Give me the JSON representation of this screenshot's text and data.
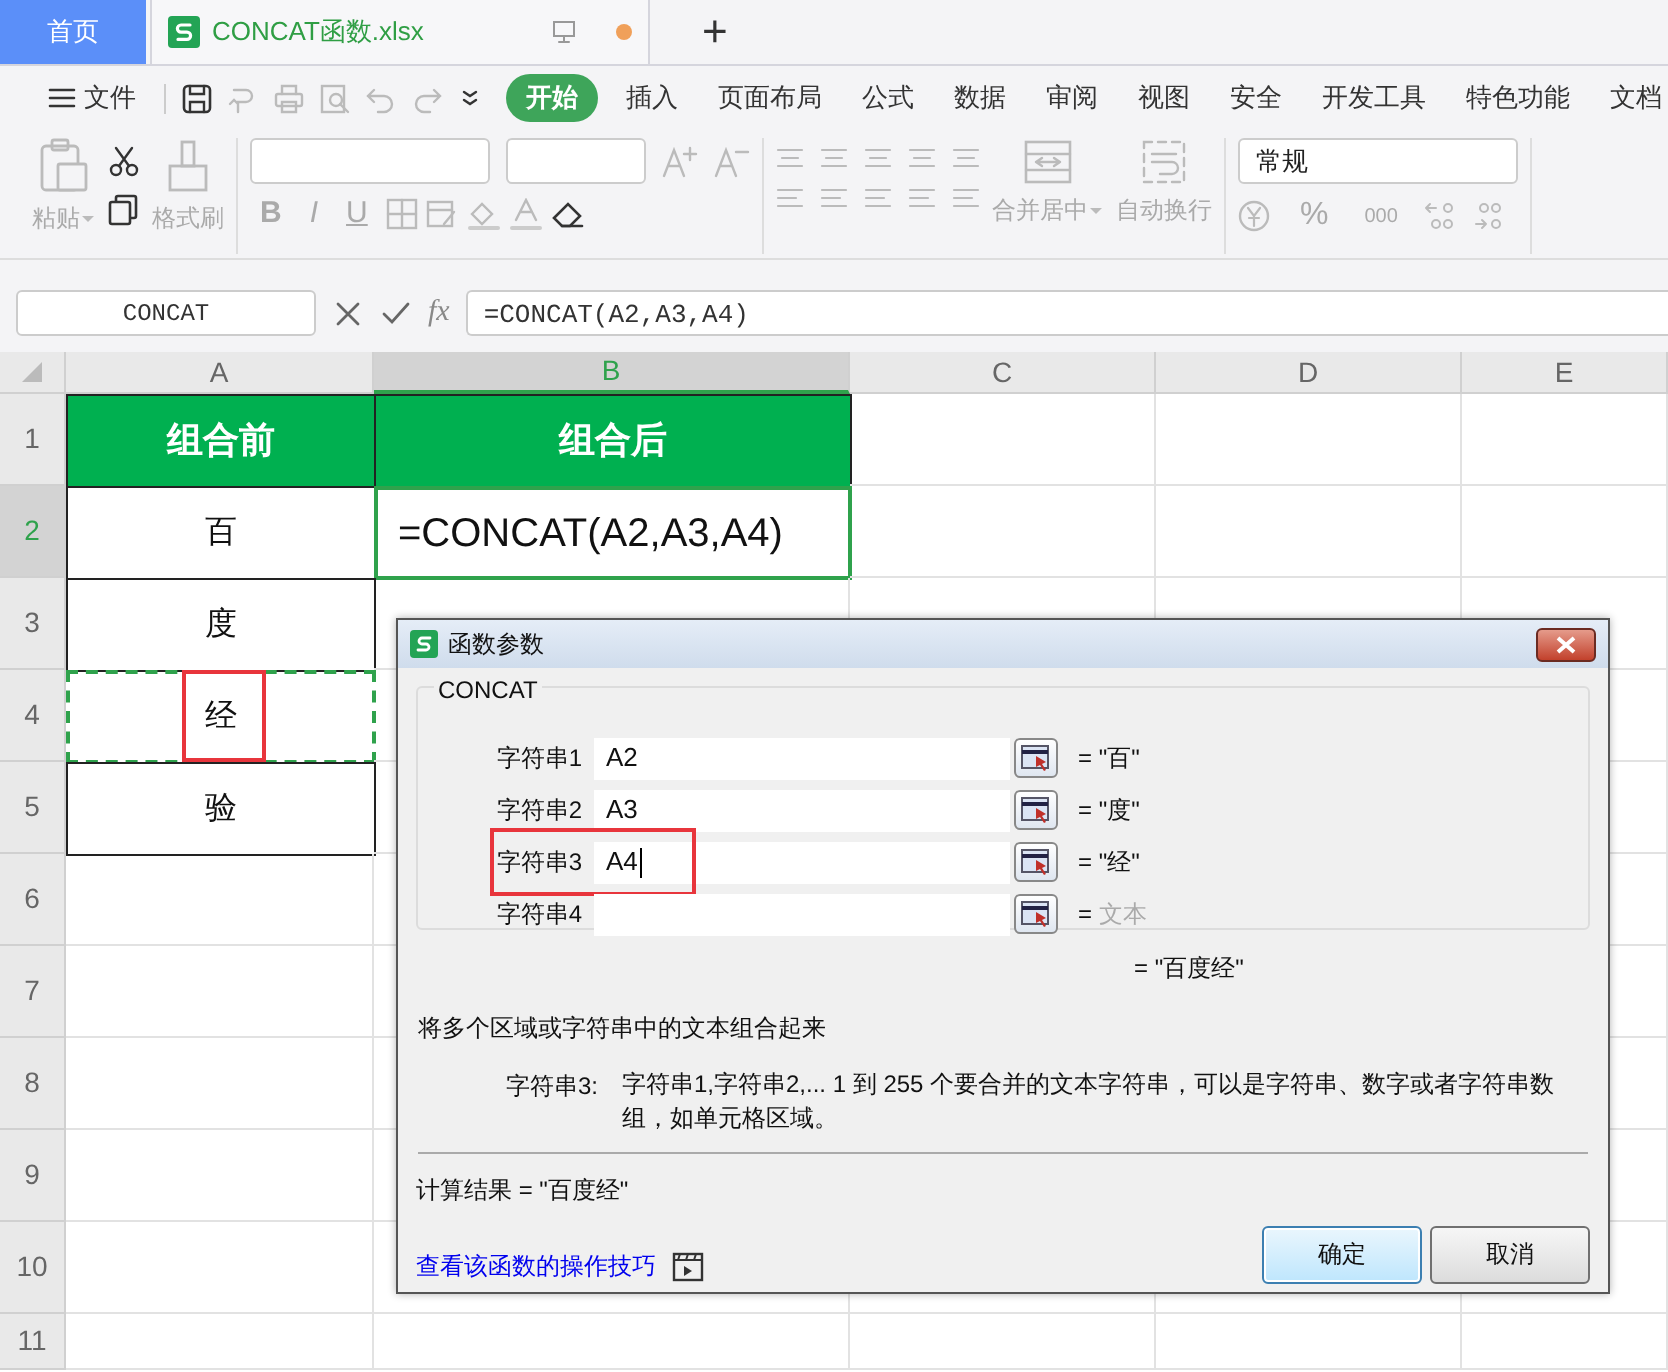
{
  "tabs": [
    {
      "label": "首页",
      "kind": "home",
      "selected": false
    },
    {
      "label": "CONCAT函数.xlsx",
      "kind": "file",
      "selected": true,
      "modified": true
    }
  ],
  "new_tab": "+",
  "file_menu": "文件",
  "menu": [
    {
      "label": "开始",
      "selected": true
    },
    {
      "label": "插入",
      "selected": false
    },
    {
      "label": "页面布局",
      "selected": false
    },
    {
      "label": "公式",
      "selected": false
    },
    {
      "label": "数据",
      "selected": false
    },
    {
      "label": "审阅",
      "selected": false
    },
    {
      "label": "视图",
      "selected": false
    },
    {
      "label": "安全",
      "selected": false
    },
    {
      "label": "开发工具",
      "selected": false
    },
    {
      "label": "特色功能",
      "selected": false
    },
    {
      "label": "文档",
      "selected": false
    }
  ],
  "ribbon": {
    "paste": "粘贴",
    "format_painter": "格式刷",
    "format_buttons": [
      "B",
      "I",
      "U"
    ],
    "merge": "合并居中",
    "wrap": "自动换行",
    "number_format": "常规",
    "number_buttons": [
      "%",
      "000"
    ]
  },
  "name_box": "CONCAT",
  "fx": "fx",
  "formula": "=CONCAT(A2,A3,A4)",
  "columns": [
    {
      "label": "A",
      "selected": false
    },
    {
      "label": "B",
      "selected": true
    },
    {
      "label": "C",
      "selected": false
    },
    {
      "label": "D",
      "selected": false
    },
    {
      "label": "E",
      "selected": false
    }
  ],
  "rows": [
    {
      "label": "1",
      "selected": false,
      "cells": [
        {
          "text": "组合前",
          "kind": "header",
          "selected": false
        },
        {
          "text": "组合后",
          "kind": "header",
          "selected": false
        }
      ]
    },
    {
      "label": "2",
      "selected": true,
      "cells": [
        {
          "text": "百",
          "kind": "value",
          "selected": false
        },
        {
          "text": "=CONCAT(A2,A3,A4)",
          "kind": "formula",
          "selected": true
        }
      ]
    },
    {
      "label": "3",
      "selected": false,
      "cells": [
        {
          "text": "度",
          "kind": "value",
          "selected": false
        }
      ]
    },
    {
      "label": "4",
      "selected": false,
      "cells": [
        {
          "text": "经",
          "kind": "value",
          "selected": false,
          "marquee": true,
          "highlighted": true
        }
      ]
    },
    {
      "label": "5",
      "selected": false,
      "cells": [
        {
          "text": "验",
          "kind": "value",
          "selected": false
        }
      ]
    },
    {
      "label": "6",
      "selected": false,
      "cells": []
    },
    {
      "label": "7",
      "selected": false,
      "cells": []
    },
    {
      "label": "8",
      "selected": false,
      "cells": []
    },
    {
      "label": "9",
      "selected": false,
      "cells": []
    },
    {
      "label": "10",
      "selected": false,
      "cells": []
    },
    {
      "label": "11",
      "selected": false,
      "cells": []
    }
  ],
  "dialog": {
    "title": "函数参数",
    "function": "CONCAT",
    "args": [
      {
        "label": "字符串1",
        "value": "A2",
        "equals": "=",
        "result": "\"百\"",
        "result_muted": false,
        "focused": false,
        "highlighted": false
      },
      {
        "label": "字符串2",
        "value": "A3",
        "equals": "=",
        "result": "\"度\"",
        "result_muted": false,
        "focused": false,
        "highlighted": false
      },
      {
        "label": "字符串3",
        "value": "A4",
        "equals": "=",
        "result": "\"经\"",
        "result_muted": false,
        "focused": true,
        "highlighted": true
      },
      {
        "label": "字符串4",
        "equals": "=",
        "result": "文本",
        "result_muted": true,
        "focused": false,
        "highlighted": false
      }
    ],
    "total_equals": "=",
    "total": "\"百度经\"",
    "description": "将多个区域或字符串中的文本组合起来",
    "param_label": "字符串3:",
    "param_desc": "字符串1,字符串2,... 1 到 255 个要合并的文本字符串，可以是字符串、数字或者字符串数组，如单元格区域。",
    "result_label": "计算结果",
    "result_equals": "=",
    "result": "\"百度经\"",
    "help_link": "查看该函数的操作技巧",
    "buttons": [
      {
        "label": "确定",
        "default": true
      },
      {
        "label": "取消",
        "default": false
      }
    ]
  }
}
